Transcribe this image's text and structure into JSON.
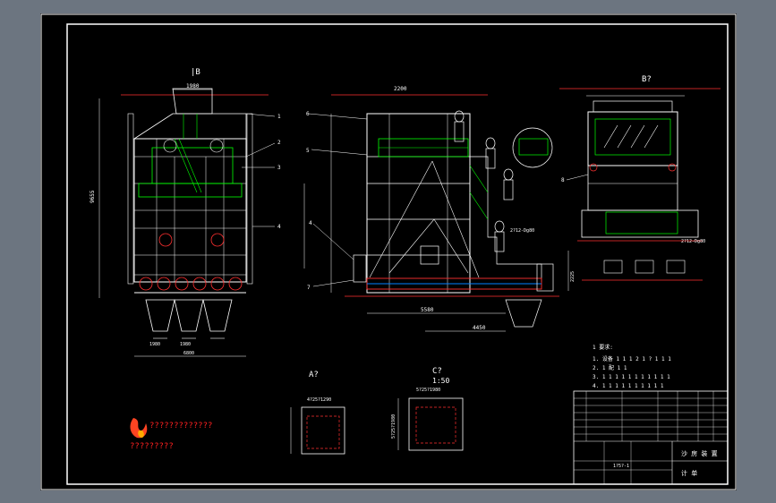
{
  "views": {
    "left_label": "|B",
    "side_label": "B?",
    "detail_a": "A?",
    "detail_c": "C?",
    "detail_c_scale": "1:50"
  },
  "dimensions": {
    "left_top": "1980",
    "left_height": "9655",
    "left_bottom_total": "6800",
    "left_bottom_a": "1980",
    "left_bottom_b": "1980",
    "mid_top": "2200",
    "mid_bottom_a": "5580",
    "mid_bottom_b": "4450",
    "mid_right_dim": "2225",
    "nozzle_a": "2?12-Dg80",
    "nozzle_b": "2?12-Dg80",
    "detail_a_dim": "4?25?1290",
    "detail_c_dim": "5?25?1980",
    "detail_c_side": "5?25?1980"
  },
  "callouts": [
    "1",
    "2",
    "3",
    "4",
    "5",
    "6",
    "7",
    "8"
  ],
  "notes": {
    "title": "1 要求:",
    "lines": [
      "1. 设备 1 1 1 2  1  ? 1 1  1",
      "2. 1 配 1 1",
      "3. 1 1 1 1 1 1 1 1 1 1  1",
      "4. 1  1 1 1 1 1 1 1 1 1"
    ]
  },
  "title_block": {
    "name": "沙 房 装 置",
    "sub": "计 单",
    "code": "1?5?-1"
  },
  "logo_text": {
    "line1": "?????????????",
    "line2": "?????????"
  }
}
